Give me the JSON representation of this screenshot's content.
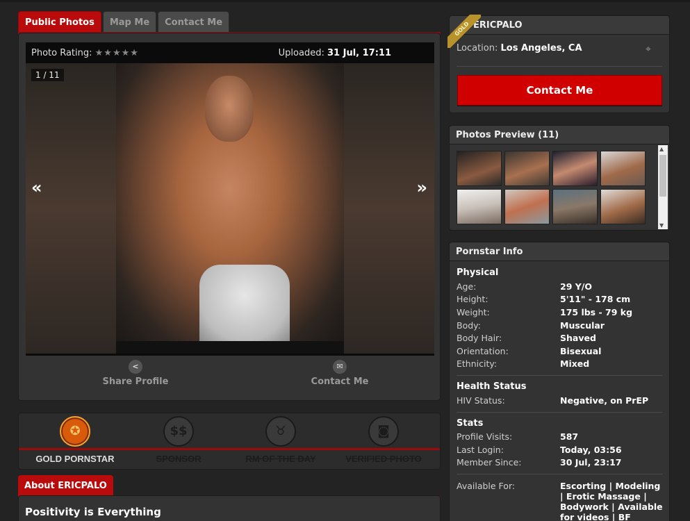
{
  "tabs": [
    "Public Photos",
    "Map Me",
    "Contact Me"
  ],
  "photo": {
    "rating_label": "Photo Rating:",
    "rating_stars": "★★★★★",
    "uploaded_label": "Uploaded:",
    "uploaded_value": "31 Jul, 17:11",
    "counter": "1 / 11",
    "prev": "«",
    "next": "»"
  },
  "actions": {
    "share": "Share Profile",
    "contact": "Contact Me"
  },
  "badges": [
    {
      "label": "GOLD PORNSTAR",
      "icon": "award-icon",
      "active": true
    },
    {
      "label": "SPONSOR",
      "icon": "dollar-icon",
      "active": false
    },
    {
      "label": "RM OF THE DAY",
      "icon": "horns-icon",
      "active": false
    },
    {
      "label": "VERIFIED PHOTO",
      "icon": "camera-icon",
      "active": false
    }
  ],
  "about": {
    "tab": "About ERICPALO",
    "title": "Positivity is Everything"
  },
  "profile": {
    "ribbon": "GOLD",
    "name": "ERICPALO",
    "location_label": "Location:",
    "location": "Los Angeles, CA",
    "contact_button": "Contact Me"
  },
  "preview": {
    "title": "Photos Preview (11)",
    "count": 8
  },
  "info": {
    "title": "Pornstar Info",
    "physical_title": "Physical",
    "physical": [
      {
        "k": "Age:",
        "v": "29 Y/O"
      },
      {
        "k": "Height:",
        "v": "5'11\" - 178 cm"
      },
      {
        "k": "Weight:",
        "v": "175 lbs - 79 kg"
      },
      {
        "k": "Body:",
        "v": "Muscular"
      },
      {
        "k": "Body Hair:",
        "v": "Shaved"
      },
      {
        "k": "Orientation:",
        "v": "Bisexual"
      },
      {
        "k": "Ethnicity:",
        "v": "Mixed"
      }
    ],
    "health_title": "Health Status",
    "health": [
      {
        "k": "HIV Status:",
        "v": "Negative, on PrEP"
      }
    ],
    "stats_title": "Stats",
    "stats": [
      {
        "k": "Profile Visits:",
        "v": "587"
      },
      {
        "k": "Last Login:",
        "v": "Today, 03:56"
      },
      {
        "k": "Member Since:",
        "v": "30 Jul, 23:17"
      }
    ],
    "available_label": "Available For:",
    "available_value": "Escorting | Modeling | Erotic Massage | Bodywork | Available for videos | BF"
  },
  "colors": {
    "accent": "#b90b0b",
    "button": "#d10000",
    "gold": "#b8922a"
  }
}
